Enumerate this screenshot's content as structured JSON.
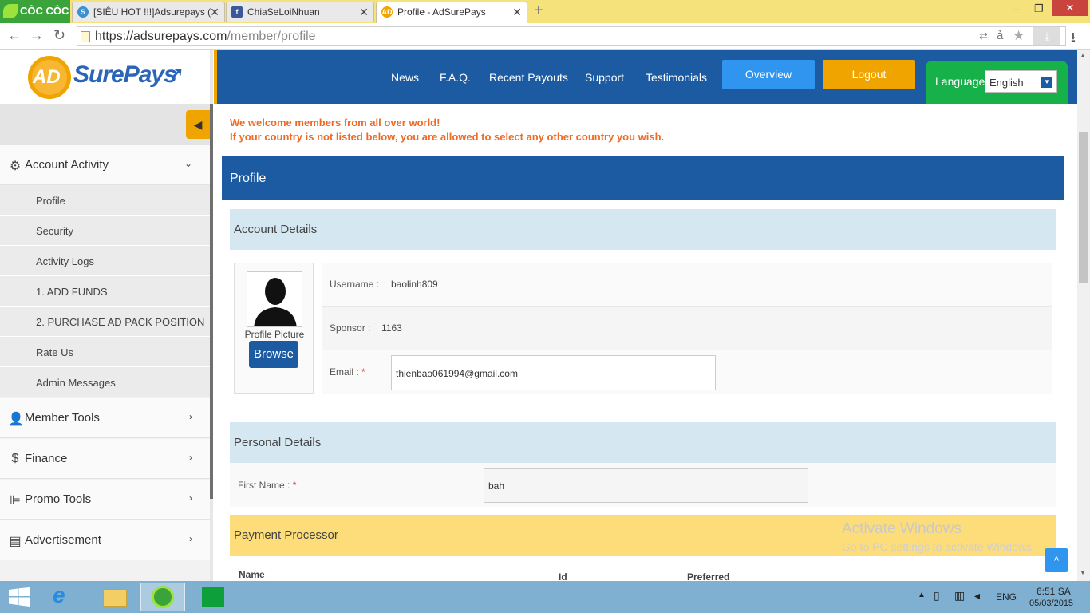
{
  "browser": {
    "brand": "CÔC CÔC",
    "tabs": [
      {
        "label": "[SIÊU HOT !!!]Adsurepays (",
        "icon": "forum-icon"
      },
      {
        "label": "ChiaSeLoiNhuan",
        "icon": "facebook-icon"
      },
      {
        "label": "Profile - AdSurePays",
        "icon": "adsurepays-icon"
      }
    ],
    "url_host": "https://adsurepays.com",
    "url_path": "/member/profile"
  },
  "logo": {
    "ad": "AD",
    "name": "SurePays"
  },
  "sidebar": {
    "sections": [
      {
        "label": "Account Activity",
        "icon": "gear-icon"
      },
      {
        "label": "Member Tools",
        "icon": "user-icon"
      },
      {
        "label": "Finance",
        "icon": "dollar-icon"
      },
      {
        "label": "Promo Tools",
        "icon": "sitemap-icon"
      },
      {
        "label": "Advertisement",
        "icon": "advert-icon"
      }
    ],
    "sub_items": [
      "Profile",
      "Security",
      "Activity Logs",
      "1. ADD FUNDS",
      "2. PURCHASE AD PACK POSITION",
      "Rate Us",
      "Admin Messages"
    ]
  },
  "header": {
    "nav": [
      "News",
      "F.A.Q.",
      "Recent Payouts",
      "Support",
      "Testimonials"
    ],
    "overview": "Overview",
    "logout": "Logout",
    "language_label": "Language",
    "language_value": "English"
  },
  "main": {
    "welcome_line1": "We welcome members from all over world!",
    "welcome_line2": "If your country is not listed below, you are allowed to select any other country you wish.",
    "page_title": "Profile",
    "account_details": "Account Details",
    "profile_picture": "Profile Picture",
    "browse": "Browse",
    "username_label": "Username :",
    "username_value": "baolinh809",
    "sponsor_label": "Sponsor :",
    "sponsor_value": "1163",
    "email_label": "Email :",
    "required_mark": "*",
    "email_value": "thienbao061994@gmail.com",
    "personal_details": "Personal Details",
    "first_name_label": "First Name :",
    "first_name_value": "bah",
    "payment_processor": "Payment Processor",
    "col_name": "Name",
    "col_id": "Id",
    "col_preferred": "Preferred"
  },
  "watermark": {
    "line1": "Activate Windows",
    "line2": "Go to PC settings to activate Windows."
  },
  "taskbar": {
    "lang": "ENG",
    "time": "6:51 SA",
    "date": "05/03/2015"
  },
  "colors": {
    "brand_blue": "#1c5ba2",
    "accent_orange": "#f0a400",
    "lang_green": "#17b14a"
  }
}
